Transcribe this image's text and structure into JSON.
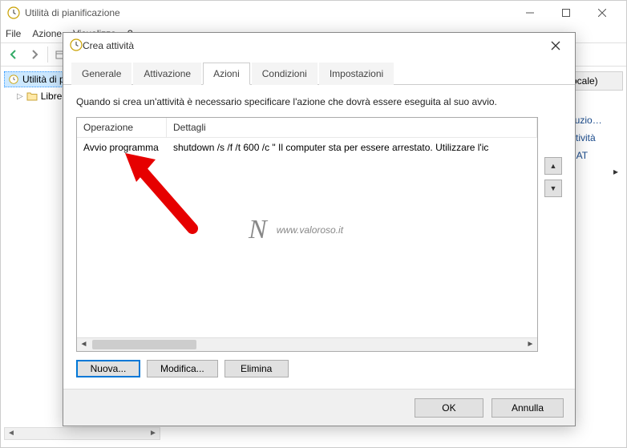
{
  "main_window": {
    "title": "Utilità di pianificazione",
    "menu": {
      "file": "File",
      "azione": "Azione",
      "visualizza": "Visualizza",
      "help": "?"
    }
  },
  "tree": {
    "root": "Utilità di pi…",
    "child": "Libreri…"
  },
  "right_panel": {
    "header": "r locale)",
    "items": [
      "…",
      "secuzio…",
      "e attività",
      "izio AT"
    ]
  },
  "dialog": {
    "title": "Crea attività",
    "tabs": {
      "generale": "Generale",
      "attivazione": "Attivazione",
      "azioni": "Azioni",
      "condizioni": "Condizioni",
      "impostazioni": "Impostazioni"
    },
    "instruction": "Quando si crea un'attività è necessario specificare l'azione che dovrà essere eseguita al suo avvio.",
    "table": {
      "col_operation": "Operazione",
      "col_details": "Dettagli",
      "row": {
        "operation": "Avvio programma",
        "details": "shutdown /s /f /t 600 /c \" Il computer sta per essere arrestato. Utilizzare l'ic"
      }
    },
    "buttons": {
      "nuova": "Nuova...",
      "modifica": "Modifica...",
      "elimina": "Elimina",
      "ok": "OK",
      "annulla": "Annulla"
    }
  },
  "watermark": "www.valoroso.it"
}
